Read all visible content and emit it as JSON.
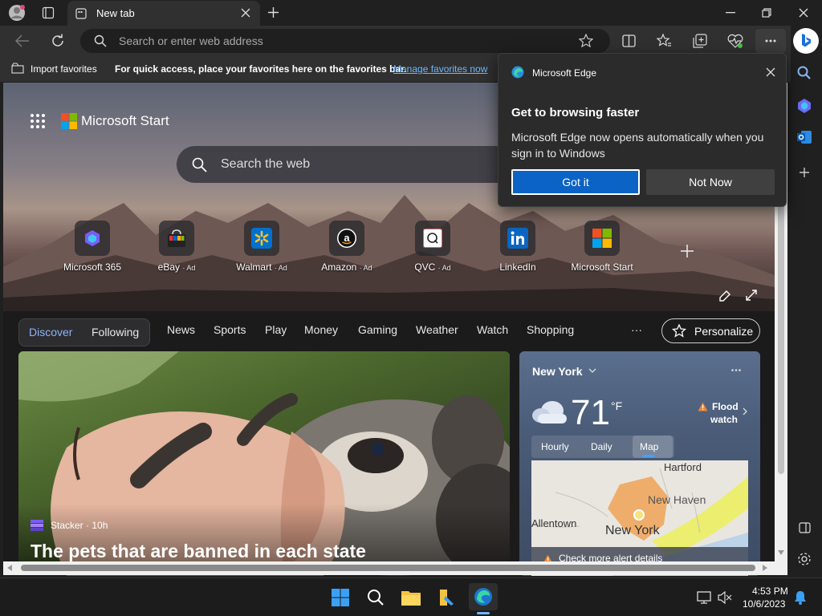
{
  "browser": {
    "tab_title": "New tab",
    "address_placeholder": "Search or enter web address"
  },
  "favorites_bar": {
    "import_label": "Import favorites",
    "message": "For quick access, place your favorites here on the favorites bar.",
    "manage_link": "Manage favorites now"
  },
  "popup": {
    "app_name": "Microsoft Edge",
    "heading": "Get to browsing faster",
    "body": "Microsoft Edge now opens automatically when you sign in to Windows",
    "primary_button": "Got it",
    "secondary_button": "Not Now"
  },
  "start_page": {
    "brand": "Microsoft Start",
    "search_placeholder": "Search the web",
    "quick_links": [
      {
        "label": "Microsoft 365",
        "ad": ""
      },
      {
        "label": "eBay",
        "ad": "· Ad"
      },
      {
        "label": "Walmart",
        "ad": "· Ad"
      },
      {
        "label": "Amazon",
        "ad": "· Ad"
      },
      {
        "label": "QVC",
        "ad": "· Ad"
      },
      {
        "label": "LinkedIn",
        "ad": ""
      },
      {
        "label": "Microsoft Start",
        "ad": ""
      }
    ],
    "nav": {
      "discover": "Discover",
      "following": "Following",
      "items": [
        "News",
        "Sports",
        "Play",
        "Money",
        "Gaming",
        "Weather",
        "Watch",
        "Shopping"
      ],
      "more": "···",
      "personalize": "Personalize"
    },
    "feature_card": {
      "source": "Stacker · 10h",
      "headline": "The pets that are banned in each state"
    },
    "weather": {
      "location": "New York",
      "temperature": "71",
      "unit": "°F",
      "alert_line1": "Flood",
      "alert_line2": "watch",
      "tabs": [
        "Hourly",
        "Daily",
        "Map"
      ],
      "active_tab": "Map",
      "map_labels": {
        "hartford": "Hartford",
        "new_haven": "New Haven",
        "allentown": "Allentown",
        "new_york": "New York"
      },
      "alert_details": "Check more alert details"
    }
  },
  "taskbar": {
    "time": "4:53 PM",
    "date": "10/6/2023"
  },
  "colors": {
    "accent": "#0b63c5",
    "link": "#6cb8ff",
    "discover": "#8ab4f8",
    "flood": "#e8883a"
  }
}
